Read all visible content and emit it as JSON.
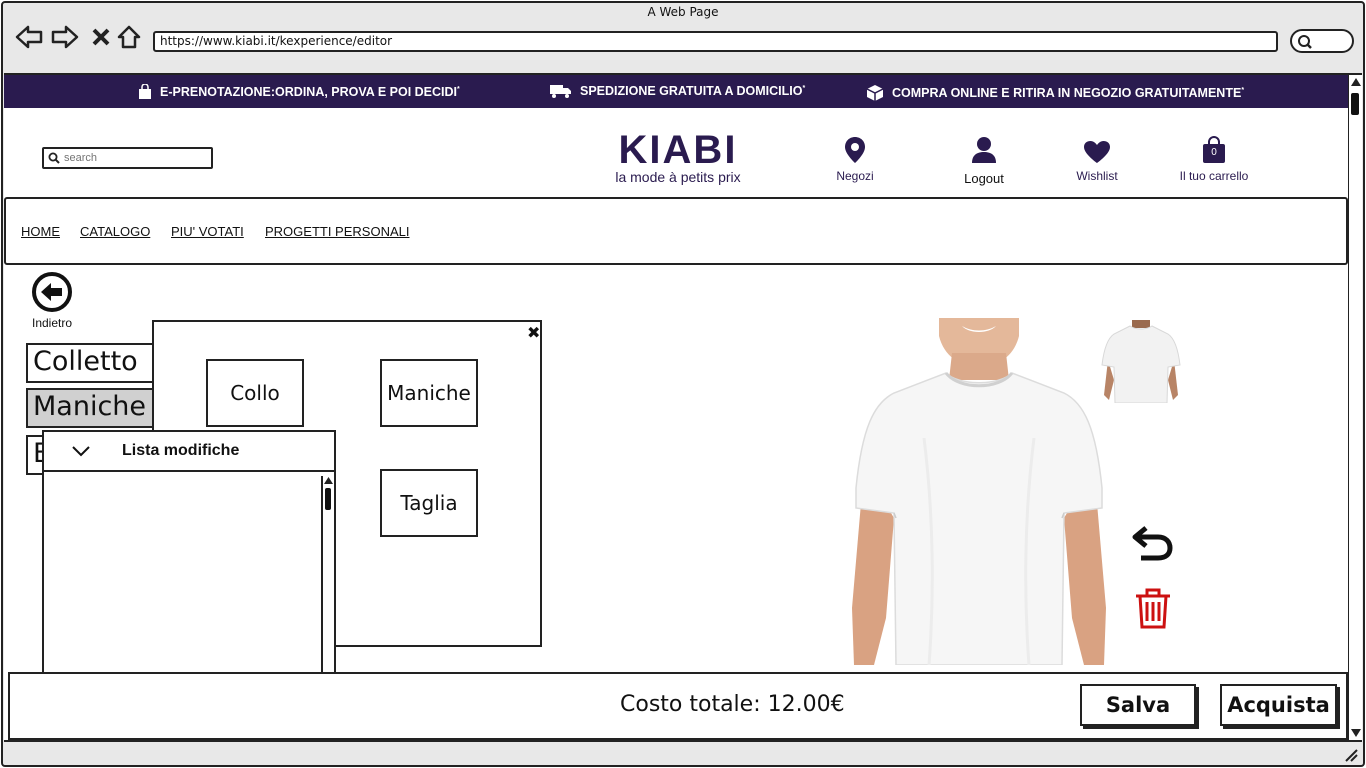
{
  "browser": {
    "title": "A Web Page",
    "url": "https://www.kiabi.it/kexperience/editor"
  },
  "promo": {
    "item1": "E-PRENOTAZIONE:ORDINA, PROVA E POI DECIDI",
    "item2": "SPEDIZIONE GRATUITA A DOMICILIO",
    "item3": "COMPRA ONLINE E RITIRA IN NEGOZIO GRATUITAMENTE",
    "marker": "*"
  },
  "header": {
    "search_placeholder": "search",
    "logo": "KIABI",
    "tagline": "la mode à petits prix",
    "stores": "Negozi",
    "logout": "Logout",
    "wishlist": "Wishlist",
    "cart": "Il tuo carrello",
    "cart_count": "0"
  },
  "nav": {
    "home": "HOME",
    "catalog": "CATALOGO",
    "top_rated": "PIU' VOTATI",
    "projects": "PROGETTI PERSONALI"
  },
  "editor": {
    "back": "Indietro",
    "tabs": [
      "Colletto",
      "Maniche",
      "B"
    ],
    "close": "✖",
    "options": [
      "Collo",
      "Maniche",
      "Taglia"
    ],
    "changes_title": "Lista modifiche"
  },
  "footer": {
    "total": "Costo totale: 12.00€",
    "save": "Salva",
    "buy": "Acquista"
  },
  "colors": {
    "brand": "#2a1b4f",
    "delete": "#cc1111"
  }
}
